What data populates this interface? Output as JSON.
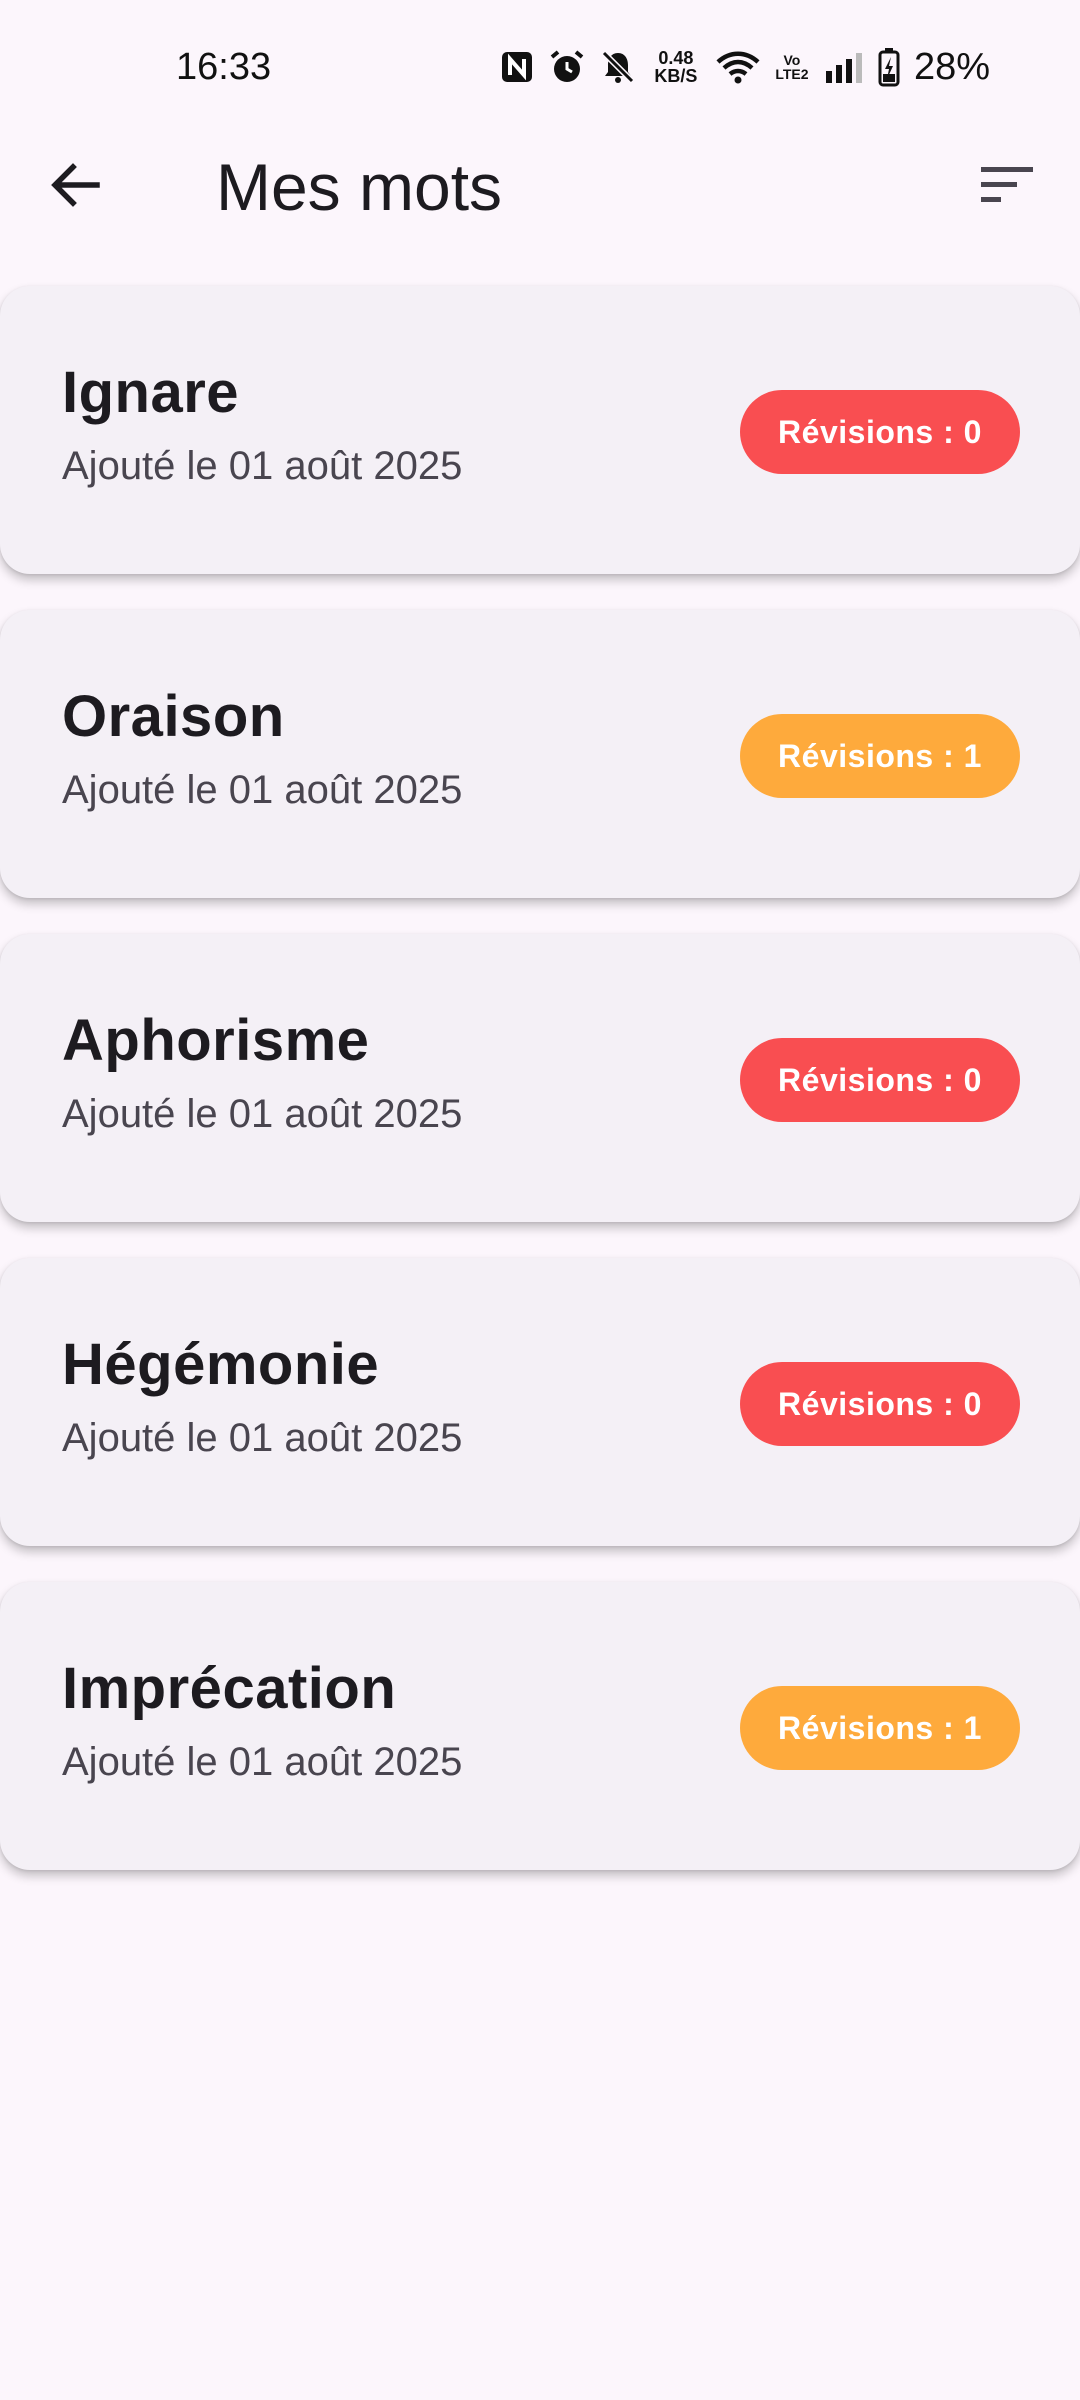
{
  "status_bar": {
    "time": "16:33",
    "speed_value": "0.48",
    "speed_unit": "KB/S",
    "volte": "Vo LTE2",
    "battery": "28%",
    "icons": [
      "nfc-icon",
      "alarm-icon",
      "bell-off-icon",
      "wifi-icon",
      "signal-icon",
      "battery-charging-icon"
    ]
  },
  "app_bar": {
    "title": "Mes mots",
    "back_icon": "arrow-back-icon",
    "sort_icon": "sort-icon"
  },
  "colors": {
    "background": "#FCF6FC",
    "card": "#F4F0F6",
    "badge_zero": "#F94E51",
    "badge_one": "#FEAA3C"
  },
  "words": [
    {
      "word": "Ignare",
      "date": "Ajouté le 01 août 2025",
      "badge": "Révisions : 0",
      "revisions": 0
    },
    {
      "word": "Oraison",
      "date": "Ajouté le 01 août 2025",
      "badge": "Révisions : 1",
      "revisions": 1
    },
    {
      "word": "Aphorisme",
      "date": "Ajouté le 01 août 2025",
      "badge": "Révisions : 0",
      "revisions": 0
    },
    {
      "word": "Hégémonie",
      "date": "Ajouté le 01 août 2025",
      "badge": "Révisions : 0",
      "revisions": 0
    },
    {
      "word": "Imprécation",
      "date": "Ajouté le 01 août 2025",
      "badge": "Révisions : 1",
      "revisions": 1
    }
  ]
}
